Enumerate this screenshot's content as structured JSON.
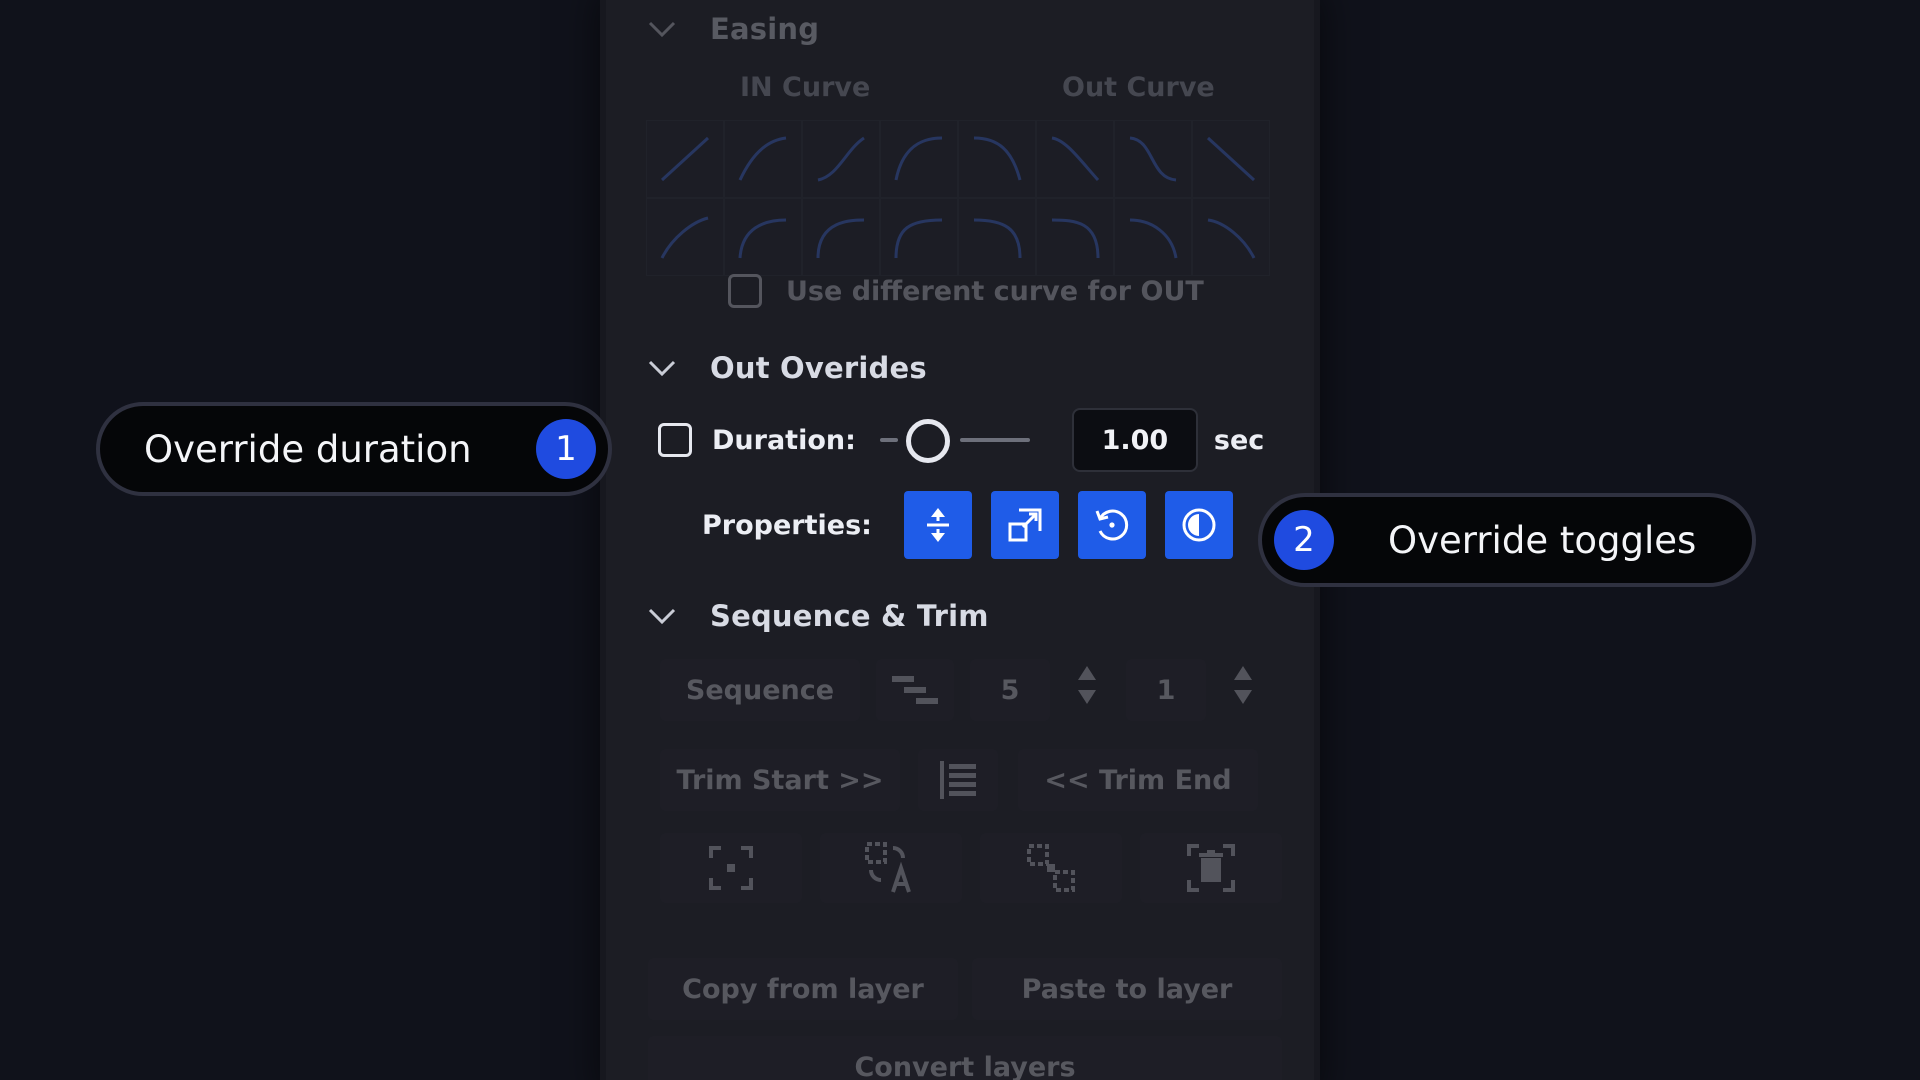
{
  "easing": {
    "title": "Easing",
    "in_curve": "IN Curve",
    "out_curve": "Out Curve",
    "different_curve_label": "Use different curve for OUT"
  },
  "out_overrides": {
    "title": "Out Overides",
    "duration_label": "Duration:",
    "duration_value": "1.00",
    "duration_unit": "sec",
    "properties_label": "Properties:"
  },
  "sequence_trim": {
    "title": "Sequence & Trim",
    "sequence_label": "Sequence",
    "sequence_value_a": "5",
    "sequence_value_b": "1",
    "trim_start": "Trim Start >>",
    "trim_end": "<< Trim End",
    "copy_from_layer": "Copy from layer",
    "paste_to_layer": "Paste to layer",
    "convert_layers": "Convert layers"
  },
  "callouts": {
    "duration": {
      "text": "Override duration",
      "badge": "1"
    },
    "toggles": {
      "text": "Override toggles",
      "badge": "2"
    }
  },
  "colors": {
    "accent": "#1f5ce8",
    "badge": "#1f4be0",
    "panel": "#1c1d24",
    "background": "#10121b"
  }
}
